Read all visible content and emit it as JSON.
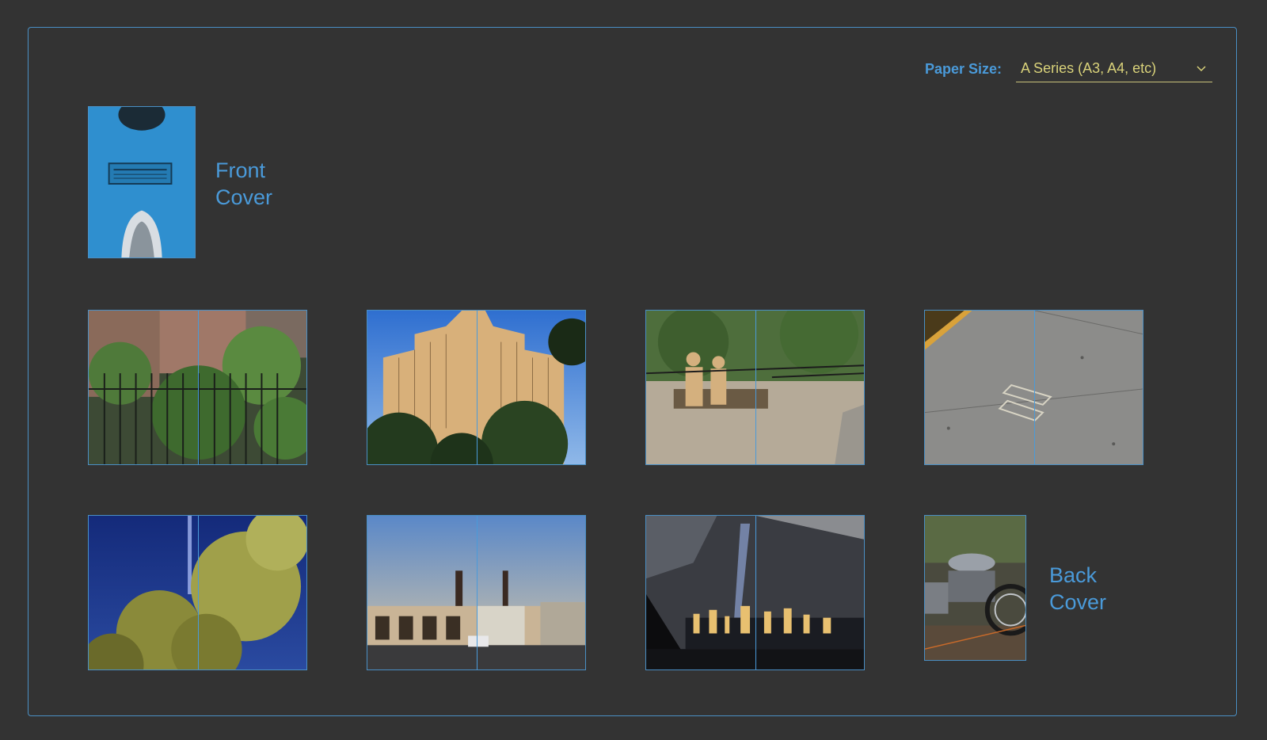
{
  "paper_size": {
    "label": "Paper Size:",
    "selected": "A Series (A3, A4, etc)"
  },
  "covers": {
    "front": [
      "Front",
      "Cover"
    ],
    "back": [
      "Back",
      "Cover"
    ]
  },
  "colors": {
    "accent": "#4a9ad9",
    "select_text": "#d9d27a",
    "background": "#333333"
  },
  "icons": {
    "dropdown": "chevron-down-icon"
  }
}
